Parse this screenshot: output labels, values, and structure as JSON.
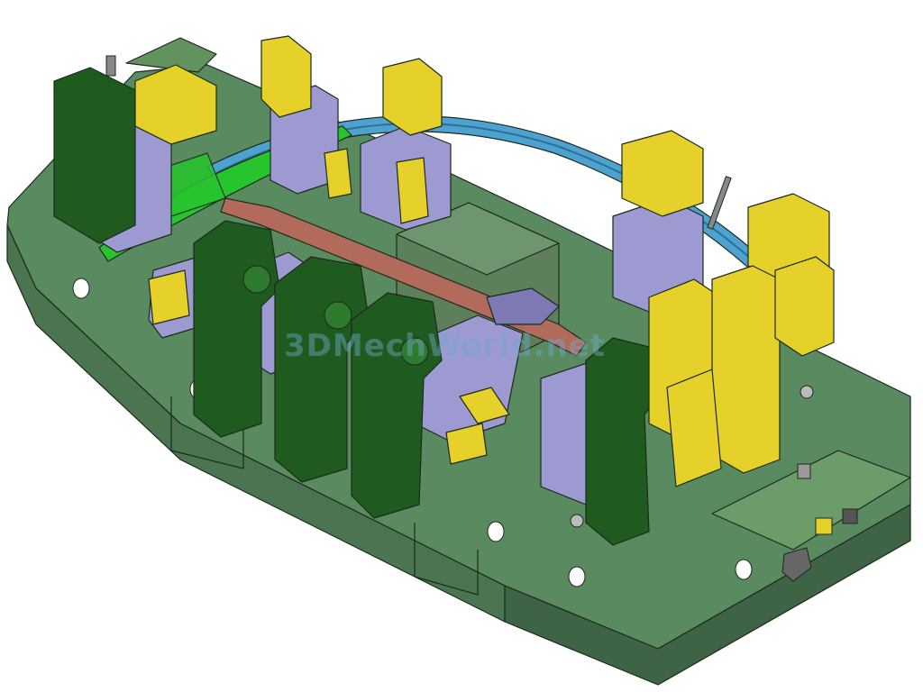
{
  "watermark": {
    "text": "3DMechWorld.net"
  },
  "colors": {
    "base_plate": "#5a8a5f",
    "base_plate_side": "#4a7550",
    "base_plate_dark": "#3f6445",
    "fixture_blocks": "#9d9ad1",
    "fixture_blocks_dark": "#7c79b3",
    "clamps_dark_green": "#1f5a1f",
    "clamps_yellow": "#e6d12a",
    "part_blue": "#4ea2cf",
    "part_green": "#27c42d",
    "rail_red": "#b26a5a",
    "center_block": "#5d7f5c"
  },
  "model": {
    "name": "fixture-assembly",
    "components": [
      "base-plate",
      "center-block",
      "curved-part-blue",
      "curved-part-green",
      "red-rail",
      "dark-green-clamp",
      "yellow-clamp",
      "lavender-support",
      "locating-pin",
      "pneumatic-cylinder",
      "lifting-handle",
      "connector-fitting"
    ]
  }
}
